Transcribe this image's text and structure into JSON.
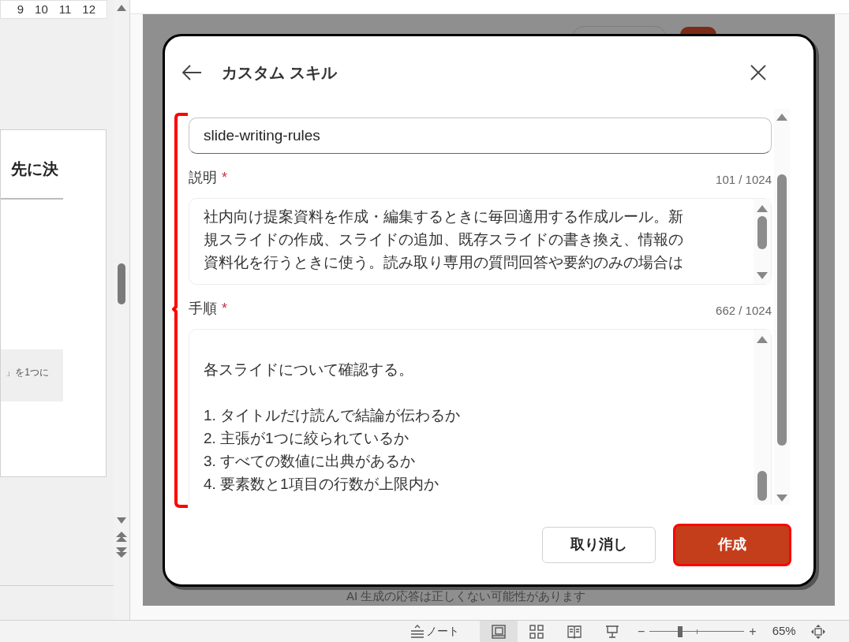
{
  "ruler": {
    "ticks": [
      "9",
      "10",
      "11",
      "12"
    ]
  },
  "slide_preview": {
    "heading": "先に決",
    "callout": "」を1つに"
  },
  "background_notice": "AI 生成の応答は正しくない可能性があります",
  "dialog": {
    "title": "カスタム スキル",
    "name_field": {
      "value": "slide-writing-rules"
    },
    "fields": [
      {
        "label": "説明",
        "required_mark": "*",
        "counter": "101 / 1024",
        "paragraphs": [
          [
            "社内向け提案資料を作成・編集するときに毎回適用する作成ルール。新",
            "規スライドの作成、スライドの追加、既存スライドの書き換え、情報の",
            "資料化を行うときに使う。読み取り専用の質問回答や要約のみの場合は"
          ]
        ],
        "leading_blank": false
      },
      {
        "label": "手順",
        "required_mark": "*",
        "counter": "662 / 1024",
        "paragraphs": [
          [
            "各スライドについて確認する。"
          ],
          [
            "1. タイトルだけ読んで結論が伝わるか",
            "2. 主張が1つに絞られているか",
            "3. すべての数値に出典があるか",
            "4. 要素数と1項目の行数が上限内か"
          ]
        ],
        "leading_blank": true
      }
    ],
    "buttons": [
      {
        "label": "取り消し",
        "kind": "secondary",
        "highlighted": false
      },
      {
        "label": "作成",
        "kind": "primary",
        "highlighted": true
      }
    ]
  },
  "status_bar": {
    "notes_label": "ノート",
    "views": [
      {
        "kind": "normal",
        "selected": true
      },
      {
        "kind": "sorter",
        "selected": false
      },
      {
        "kind": "reading",
        "selected": false
      },
      {
        "kind": "presenter",
        "selected": false
      }
    ],
    "zoom": {
      "minus": "−",
      "plus": "+",
      "level": 0.31,
      "reading": "65%"
    }
  }
}
